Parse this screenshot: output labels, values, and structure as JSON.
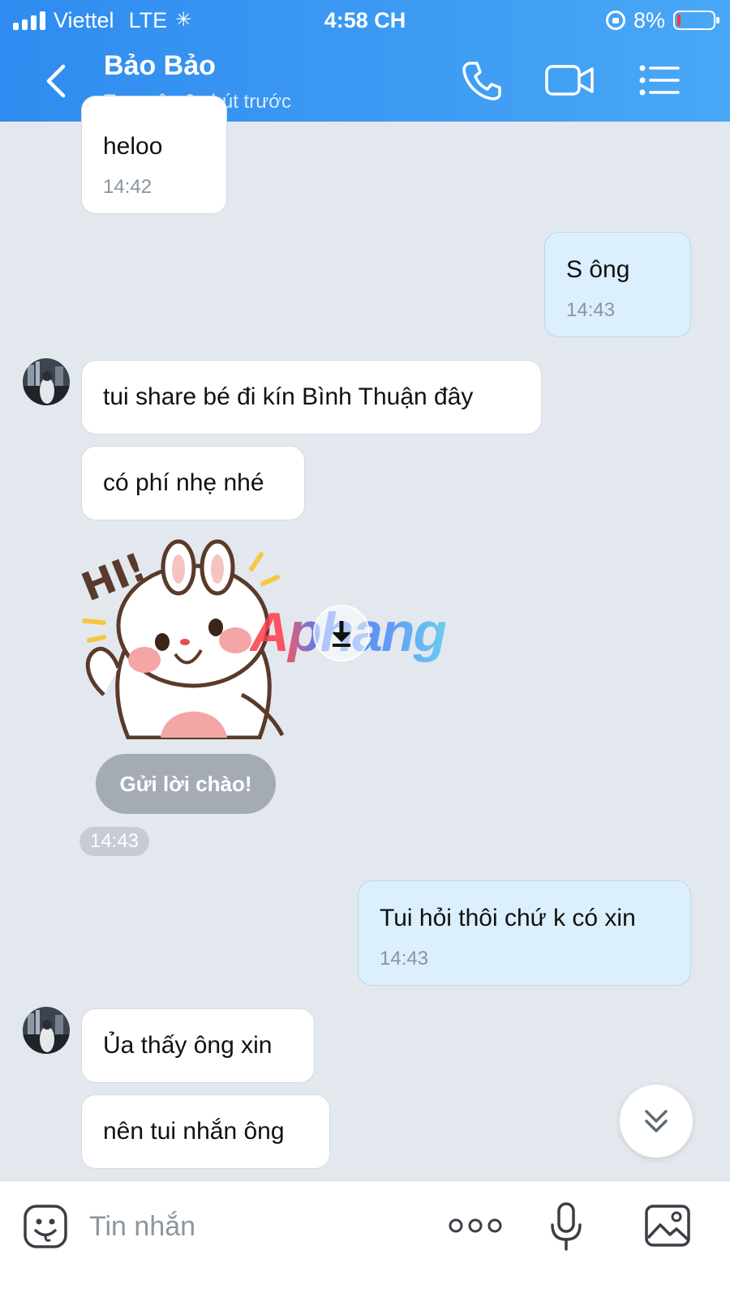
{
  "status_bar": {
    "carrier": "Viettel",
    "network": "LTE",
    "time": "4:58 CH",
    "battery": "8%"
  },
  "header": {
    "contact_name": "Bảo Bảo",
    "contact_status": "Truy cập 6 phút trước"
  },
  "messages": [
    {
      "direction": "received",
      "text": "heloo",
      "time": "14:42"
    },
    {
      "direction": "sent",
      "text": "S ông",
      "time": "14:43"
    },
    {
      "direction": "received",
      "text": "tui share bé đi kín Bình Thuận đây"
    },
    {
      "direction": "received",
      "text": "có phí nhẹ nhé"
    },
    {
      "direction": "received",
      "type": "sticker",
      "sticker_text": "HI!",
      "time": "14:43"
    },
    {
      "direction": "sent",
      "text": "Tui hỏi thôi chứ k có xin",
      "time": "14:43"
    },
    {
      "direction": "received",
      "text": "Ủa thấy ông xin"
    },
    {
      "direction": "received",
      "text": "nên tui nhắn ông"
    }
  ],
  "greeting_chip": "Gửi lời chào!",
  "watermark": "Aphang",
  "composer": {
    "placeholder": "Tin nhắn"
  },
  "colors": {
    "header_start": "#2f8cf0",
    "header_end": "#49a8f6",
    "chat_background": "#e3e8ef",
    "sent_bubble": "#dbeffd",
    "received_bubble": "#ffffff"
  }
}
